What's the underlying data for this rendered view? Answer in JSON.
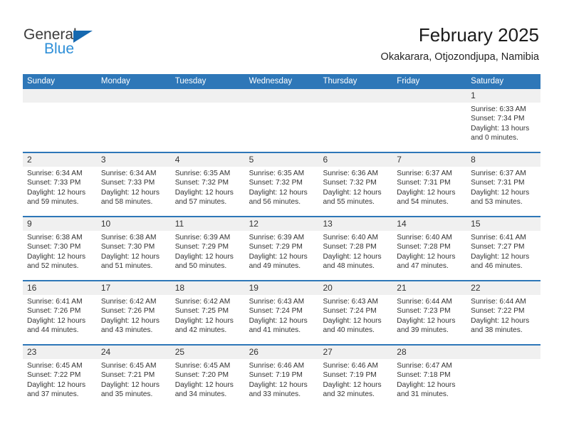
{
  "brand": {
    "word_one": "General",
    "word_two": "Blue",
    "triangle_color": "#1669b0",
    "blue_color": "#2e8fd8"
  },
  "header": {
    "title": "February 2025",
    "subtitle": "Okakarara, Otjozondjupa, Namibia"
  },
  "theme": {
    "header_blue": "#2e77b8",
    "daynum_band": "#f0f0f0",
    "text": "#333333"
  },
  "weekdays": [
    "Sunday",
    "Monday",
    "Tuesday",
    "Wednesday",
    "Thursday",
    "Friday",
    "Saturday"
  ],
  "weeks": [
    {
      "days": [
        {
          "empty": true,
          "number": "",
          "lines": [
            "",
            "",
            "",
            ""
          ]
        },
        {
          "empty": true,
          "number": "",
          "lines": [
            "",
            "",
            "",
            ""
          ]
        },
        {
          "empty": true,
          "number": "",
          "lines": [
            "",
            "",
            "",
            ""
          ]
        },
        {
          "empty": true,
          "number": "",
          "lines": [
            "",
            "",
            "",
            ""
          ]
        },
        {
          "empty": true,
          "number": "",
          "lines": [
            "",
            "",
            "",
            ""
          ]
        },
        {
          "empty": true,
          "number": "",
          "lines": [
            "",
            "",
            "",
            ""
          ]
        },
        {
          "empty": false,
          "number": "1",
          "lines": [
            "Sunrise: 6:33 AM",
            "Sunset: 7:34 PM",
            "Daylight: 13 hours",
            "and 0 minutes."
          ]
        }
      ]
    },
    {
      "days": [
        {
          "empty": false,
          "number": "2",
          "lines": [
            "Sunrise: 6:34 AM",
            "Sunset: 7:33 PM",
            "Daylight: 12 hours",
            "and 59 minutes."
          ]
        },
        {
          "empty": false,
          "number": "3",
          "lines": [
            "Sunrise: 6:34 AM",
            "Sunset: 7:33 PM",
            "Daylight: 12 hours",
            "and 58 minutes."
          ]
        },
        {
          "empty": false,
          "number": "4",
          "lines": [
            "Sunrise: 6:35 AM",
            "Sunset: 7:32 PM",
            "Daylight: 12 hours",
            "and 57 minutes."
          ]
        },
        {
          "empty": false,
          "number": "5",
          "lines": [
            "Sunrise: 6:35 AM",
            "Sunset: 7:32 PM",
            "Daylight: 12 hours",
            "and 56 minutes."
          ]
        },
        {
          "empty": false,
          "number": "6",
          "lines": [
            "Sunrise: 6:36 AM",
            "Sunset: 7:32 PM",
            "Daylight: 12 hours",
            "and 55 minutes."
          ]
        },
        {
          "empty": false,
          "number": "7",
          "lines": [
            "Sunrise: 6:37 AM",
            "Sunset: 7:31 PM",
            "Daylight: 12 hours",
            "and 54 minutes."
          ]
        },
        {
          "empty": false,
          "number": "8",
          "lines": [
            "Sunrise: 6:37 AM",
            "Sunset: 7:31 PM",
            "Daylight: 12 hours",
            "and 53 minutes."
          ]
        }
      ]
    },
    {
      "days": [
        {
          "empty": false,
          "number": "9",
          "lines": [
            "Sunrise: 6:38 AM",
            "Sunset: 7:30 PM",
            "Daylight: 12 hours",
            "and 52 minutes."
          ]
        },
        {
          "empty": false,
          "number": "10",
          "lines": [
            "Sunrise: 6:38 AM",
            "Sunset: 7:30 PM",
            "Daylight: 12 hours",
            "and 51 minutes."
          ]
        },
        {
          "empty": false,
          "number": "11",
          "lines": [
            "Sunrise: 6:39 AM",
            "Sunset: 7:29 PM",
            "Daylight: 12 hours",
            "and 50 minutes."
          ]
        },
        {
          "empty": false,
          "number": "12",
          "lines": [
            "Sunrise: 6:39 AM",
            "Sunset: 7:29 PM",
            "Daylight: 12 hours",
            "and 49 minutes."
          ]
        },
        {
          "empty": false,
          "number": "13",
          "lines": [
            "Sunrise: 6:40 AM",
            "Sunset: 7:28 PM",
            "Daylight: 12 hours",
            "and 48 minutes."
          ]
        },
        {
          "empty": false,
          "number": "14",
          "lines": [
            "Sunrise: 6:40 AM",
            "Sunset: 7:28 PM",
            "Daylight: 12 hours",
            "and 47 minutes."
          ]
        },
        {
          "empty": false,
          "number": "15",
          "lines": [
            "Sunrise: 6:41 AM",
            "Sunset: 7:27 PM",
            "Daylight: 12 hours",
            "and 46 minutes."
          ]
        }
      ]
    },
    {
      "days": [
        {
          "empty": false,
          "number": "16",
          "lines": [
            "Sunrise: 6:41 AM",
            "Sunset: 7:26 PM",
            "Daylight: 12 hours",
            "and 44 minutes."
          ]
        },
        {
          "empty": false,
          "number": "17",
          "lines": [
            "Sunrise: 6:42 AM",
            "Sunset: 7:26 PM",
            "Daylight: 12 hours",
            "and 43 minutes."
          ]
        },
        {
          "empty": false,
          "number": "18",
          "lines": [
            "Sunrise: 6:42 AM",
            "Sunset: 7:25 PM",
            "Daylight: 12 hours",
            "and 42 minutes."
          ]
        },
        {
          "empty": false,
          "number": "19",
          "lines": [
            "Sunrise: 6:43 AM",
            "Sunset: 7:24 PM",
            "Daylight: 12 hours",
            "and 41 minutes."
          ]
        },
        {
          "empty": false,
          "number": "20",
          "lines": [
            "Sunrise: 6:43 AM",
            "Sunset: 7:24 PM",
            "Daylight: 12 hours",
            "and 40 minutes."
          ]
        },
        {
          "empty": false,
          "number": "21",
          "lines": [
            "Sunrise: 6:44 AM",
            "Sunset: 7:23 PM",
            "Daylight: 12 hours",
            "and 39 minutes."
          ]
        },
        {
          "empty": false,
          "number": "22",
          "lines": [
            "Sunrise: 6:44 AM",
            "Sunset: 7:22 PM",
            "Daylight: 12 hours",
            "and 38 minutes."
          ]
        }
      ]
    },
    {
      "days": [
        {
          "empty": false,
          "number": "23",
          "lines": [
            "Sunrise: 6:45 AM",
            "Sunset: 7:22 PM",
            "Daylight: 12 hours",
            "and 37 minutes."
          ]
        },
        {
          "empty": false,
          "number": "24",
          "lines": [
            "Sunrise: 6:45 AM",
            "Sunset: 7:21 PM",
            "Daylight: 12 hours",
            "and 35 minutes."
          ]
        },
        {
          "empty": false,
          "number": "25",
          "lines": [
            "Sunrise: 6:45 AM",
            "Sunset: 7:20 PM",
            "Daylight: 12 hours",
            "and 34 minutes."
          ]
        },
        {
          "empty": false,
          "number": "26",
          "lines": [
            "Sunrise: 6:46 AM",
            "Sunset: 7:19 PM",
            "Daylight: 12 hours",
            "and 33 minutes."
          ]
        },
        {
          "empty": false,
          "number": "27",
          "lines": [
            "Sunrise: 6:46 AM",
            "Sunset: 7:19 PM",
            "Daylight: 12 hours",
            "and 32 minutes."
          ]
        },
        {
          "empty": false,
          "number": "28",
          "lines": [
            "Sunrise: 6:47 AM",
            "Sunset: 7:18 PM",
            "Daylight: 12 hours",
            "and 31 minutes."
          ]
        },
        {
          "empty": true,
          "number": "",
          "lines": [
            "",
            "",
            "",
            ""
          ]
        }
      ]
    }
  ]
}
